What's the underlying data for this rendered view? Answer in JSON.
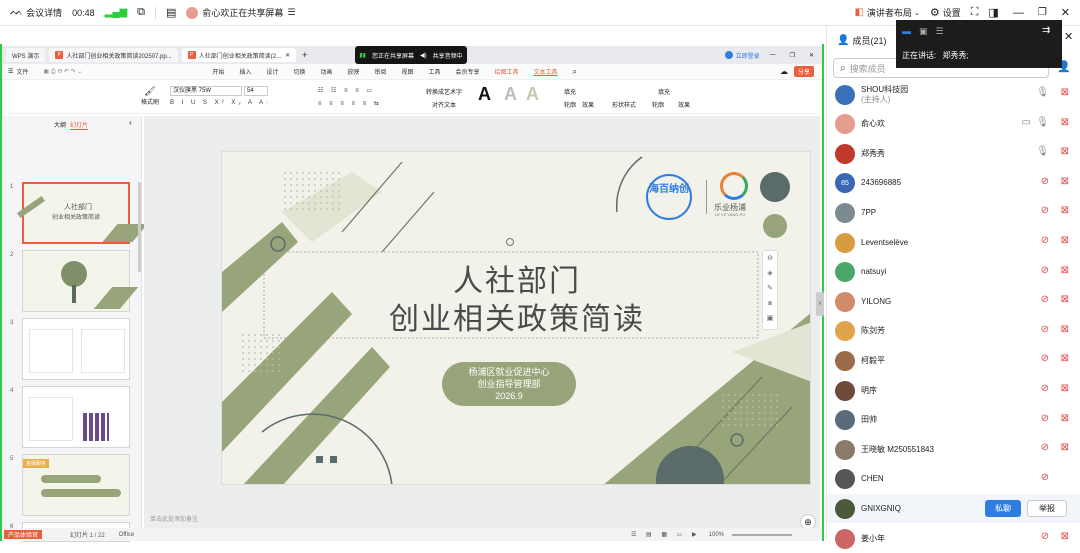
{
  "topbar": {
    "meeting_details": "会议详情",
    "timer": "00:48",
    "sharing_user": "俞心欢正在共享屏幕",
    "presenter_layout": "演讲者布局",
    "settings": "设置"
  },
  "wps": {
    "tabs": [
      {
        "label": "WPS 演示"
      },
      {
        "label": "人社部门创业相关政策简读202507.pp..."
      },
      {
        "label": "人社部门创业相关政策简读(2..."
      }
    ],
    "login": "立即登录",
    "share_btn": "分享",
    "file_menu": "文件",
    "menus": [
      "开始",
      "插入",
      "设计",
      "切换",
      "动画",
      "放映",
      "审阅",
      "视图",
      "工具",
      "会员专享"
    ],
    "highlight_menus": [
      "绘图工具",
      "文本工具"
    ],
    "font_name": "汉仪旗黑 75W",
    "font_size": "54",
    "format_brush": "格式刷",
    "convert_art": "转换成艺术字",
    "align_text": "对齐文本",
    "fill": "填充",
    "outline": "轮廓",
    "effects": "效果",
    "shape_style": "形状样式",
    "panel_tabs": [
      "大纲",
      "幻灯片"
    ],
    "notes_placeholder": "单击此处添加备注",
    "slide_counter": "幻灯片 1 / 22",
    "office_label": "Office",
    "zoom": "100%",
    "product_badge": "产品体验官",
    "thumb_nums": [
      "1",
      "2",
      "3",
      "4",
      "5",
      "6"
    ],
    "thumb1_title": "人社部门",
    "thumb1_sub": "创业相关政策简读",
    "thumb5_label": "金融服务"
  },
  "sharing_pill": {
    "status": "您正在共享屏幕",
    "action": "共享音频中"
  },
  "slide": {
    "title_line1": "人社部门",
    "title_line2": "创业相关政策简读",
    "org_line1": "杨浦区就业促进中心",
    "org_line2": "创业指导管理部",
    "date": "2026.9",
    "logo1": "海百纳创",
    "logo2": "乐业杨浦",
    "logo2_en": "LE YE YANG PU"
  },
  "speaker_box": {
    "label": "正在讲话:",
    "name": "郑秀秀;"
  },
  "members": {
    "header": "成员(21)",
    "search_placeholder": "搜索成员",
    "list": [
      {
        "name": "SHOU科技园",
        "sub": "(主持人)",
        "avatar_color": "#3b6fb8"
      },
      {
        "name": "俞心欢",
        "sub": "",
        "avatar_color": "#e59b8d"
      },
      {
        "name": "郑秀秀",
        "sub": "",
        "avatar_color": "#c0392b"
      },
      {
        "name": "243696885",
        "sub": "",
        "avatar_color": "#3a66b4",
        "initials": "85"
      },
      {
        "name": "7PP",
        "sub": "",
        "avatar_color": "#7b8b90"
      },
      {
        "name": "Leventselève",
        "sub": "",
        "avatar_color": "#d99b3f"
      },
      {
        "name": "natsuyi",
        "sub": "",
        "avatar_color": "#4aa66a"
      },
      {
        "name": "YILONG",
        "sub": "",
        "avatar_color": "#d08b6a"
      },
      {
        "name": "陈剑芳",
        "sub": "",
        "avatar_color": "#e0a34a"
      },
      {
        "name": "柯毅平",
        "sub": "",
        "avatar_color": "#9b6b4a"
      },
      {
        "name": "明序",
        "sub": "",
        "avatar_color": "#704a3b"
      },
      {
        "name": "田帅",
        "sub": "",
        "avatar_color": "#5a6a7a"
      },
      {
        "name": "王晓敏 M250551843",
        "sub": "",
        "avatar_color": "#8b7a68"
      },
      {
        "name": "CHEN",
        "sub": "",
        "avatar_color": "#555555"
      },
      {
        "name": "GNIXGNIQ",
        "sub": "",
        "avatar_color": "#4a5a3a"
      },
      {
        "name": "姜小年",
        "sub": "",
        "avatar_color": "#c66"
      }
    ],
    "private_chat": "私聊",
    "report": "举报"
  },
  "colors": {
    "accent": "#2f7de1",
    "olive": "#98a57a",
    "slate": "#5a6b6a",
    "green_border": "#2ecc40",
    "wps_orange": "#e8603c"
  }
}
